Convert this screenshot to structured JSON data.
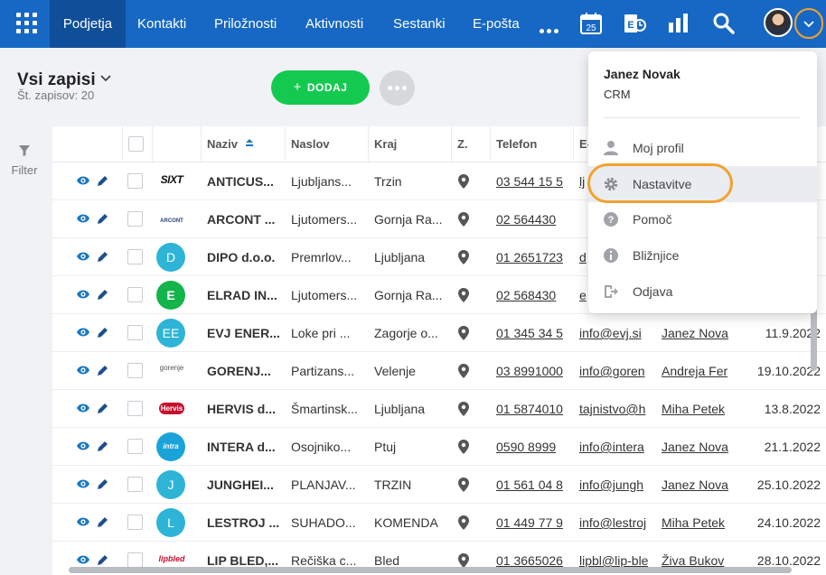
{
  "nav": {
    "items": [
      "Podjetja",
      "Kontakti",
      "Priložnosti",
      "Aktivnosti",
      "Sestanki",
      "E-pošta"
    ],
    "active": "Podjetja",
    "calendar_day": "25",
    "icons": [
      "apps-grid-icon",
      "more-dots-icon",
      "calendar-icon",
      "exchange-icon",
      "reports-chart-icon",
      "search-icon",
      "user-avatar",
      "chevron-down-icon"
    ]
  },
  "header": {
    "title": "Vsi zapisi",
    "subtitle": "Št. zapisov: 20",
    "add_label": "DODAJ"
  },
  "filter": {
    "label": "Filter"
  },
  "table": {
    "columns": [
      "Naziv",
      "Naslov",
      "Kraj",
      "Z.",
      "Telefon",
      "E-"
    ],
    "rows": [
      {
        "logo": "SIXT",
        "name": "ANTICUS...",
        "address": "Ljubljans...",
        "city": "Trzin",
        "phone": "03 544 15 5",
        "email": "lj",
        "owner": "",
        "date": ""
      },
      {
        "logo": "ARCONT",
        "name": "ARCONT ...",
        "address": "Ljutomers...",
        "city": "Gornja Ra...",
        "phone": "02 564430",
        "email": "",
        "owner": "",
        "date": ""
      },
      {
        "logo": "D",
        "name": "DIPO d.o.o.",
        "address": "Premrlov...",
        "city": "Ljubljana",
        "phone": "01 2651723",
        "email": "d",
        "owner": "",
        "date": ""
      },
      {
        "logo": "E",
        "name": "ELRAD IN...",
        "address": "Ljutomers...",
        "city": "Gornja Ra...",
        "phone": "02 568430",
        "email": "e",
        "owner": "",
        "date": ""
      },
      {
        "logo": "EE",
        "name": "EVJ ENER...",
        "address": "Loke pri ...",
        "city": "Zagorje o...",
        "phone": "01 345 34 5",
        "email": "info@evj.si",
        "owner": "Janez Nova",
        "date": "11.9.2022"
      },
      {
        "logo": "gorenje",
        "name": "GORENJ...",
        "address": "Partizans...",
        "city": "Velenje",
        "phone": "03 8991000",
        "email": "info@goren",
        "owner": "Andreja Fer",
        "date": "19.10.2022"
      },
      {
        "logo": "Hervis",
        "name": "HERVIS d...",
        "address": "Šmartinsk...",
        "city": "Ljubljana",
        "phone": "01 5874010",
        "email": "tajnistvo@h",
        "owner": "Miha Petek",
        "date": "13.8.2022"
      },
      {
        "logo": "intra",
        "name": "INTERA d...",
        "address": "Osojniko...",
        "city": "Ptuj",
        "phone": "0590 8999",
        "email": "info@intera",
        "owner": "Janez Nova",
        "date": "21.1.2022"
      },
      {
        "logo": "J",
        "name": "JUNGHEI...",
        "address": "PLANJAV...",
        "city": "TRZIN",
        "phone": "01 561 04 8",
        "email": "info@jungh",
        "owner": "Janez Nova",
        "date": "25.10.2022"
      },
      {
        "logo": "L",
        "name": "LESTROJ ...",
        "address": "SUHADO...",
        "city": "KOMENDA",
        "phone": "01 449 77 9",
        "email": "info@lestroj",
        "owner": "Miha Petek",
        "date": "24.10.2022"
      },
      {
        "logo": "lipbled",
        "name": "LIP BLED,...",
        "address": "Rečiška c...",
        "city": "Bled",
        "phone": "01 3665026",
        "email": "lipbl@lip-ble",
        "owner": "Živa Bukov",
        "date": "28.10.2022"
      }
    ]
  },
  "dropdown": {
    "user_name": "Janez Novak",
    "user_role": "CRM",
    "items": [
      "Moj profil",
      "Nastavitve",
      "Pomoč",
      "Bližnjice",
      "Odjava"
    ],
    "highlighted": "Nastavitve"
  },
  "colors": {
    "nav_bg": "#1668c4",
    "nav_active": "#0f4f99",
    "add_button": "#14c94f",
    "highlight_ring": "#f2a22e",
    "avatar_teal": "#2db4d7",
    "action_blue": "#1a78c2"
  }
}
